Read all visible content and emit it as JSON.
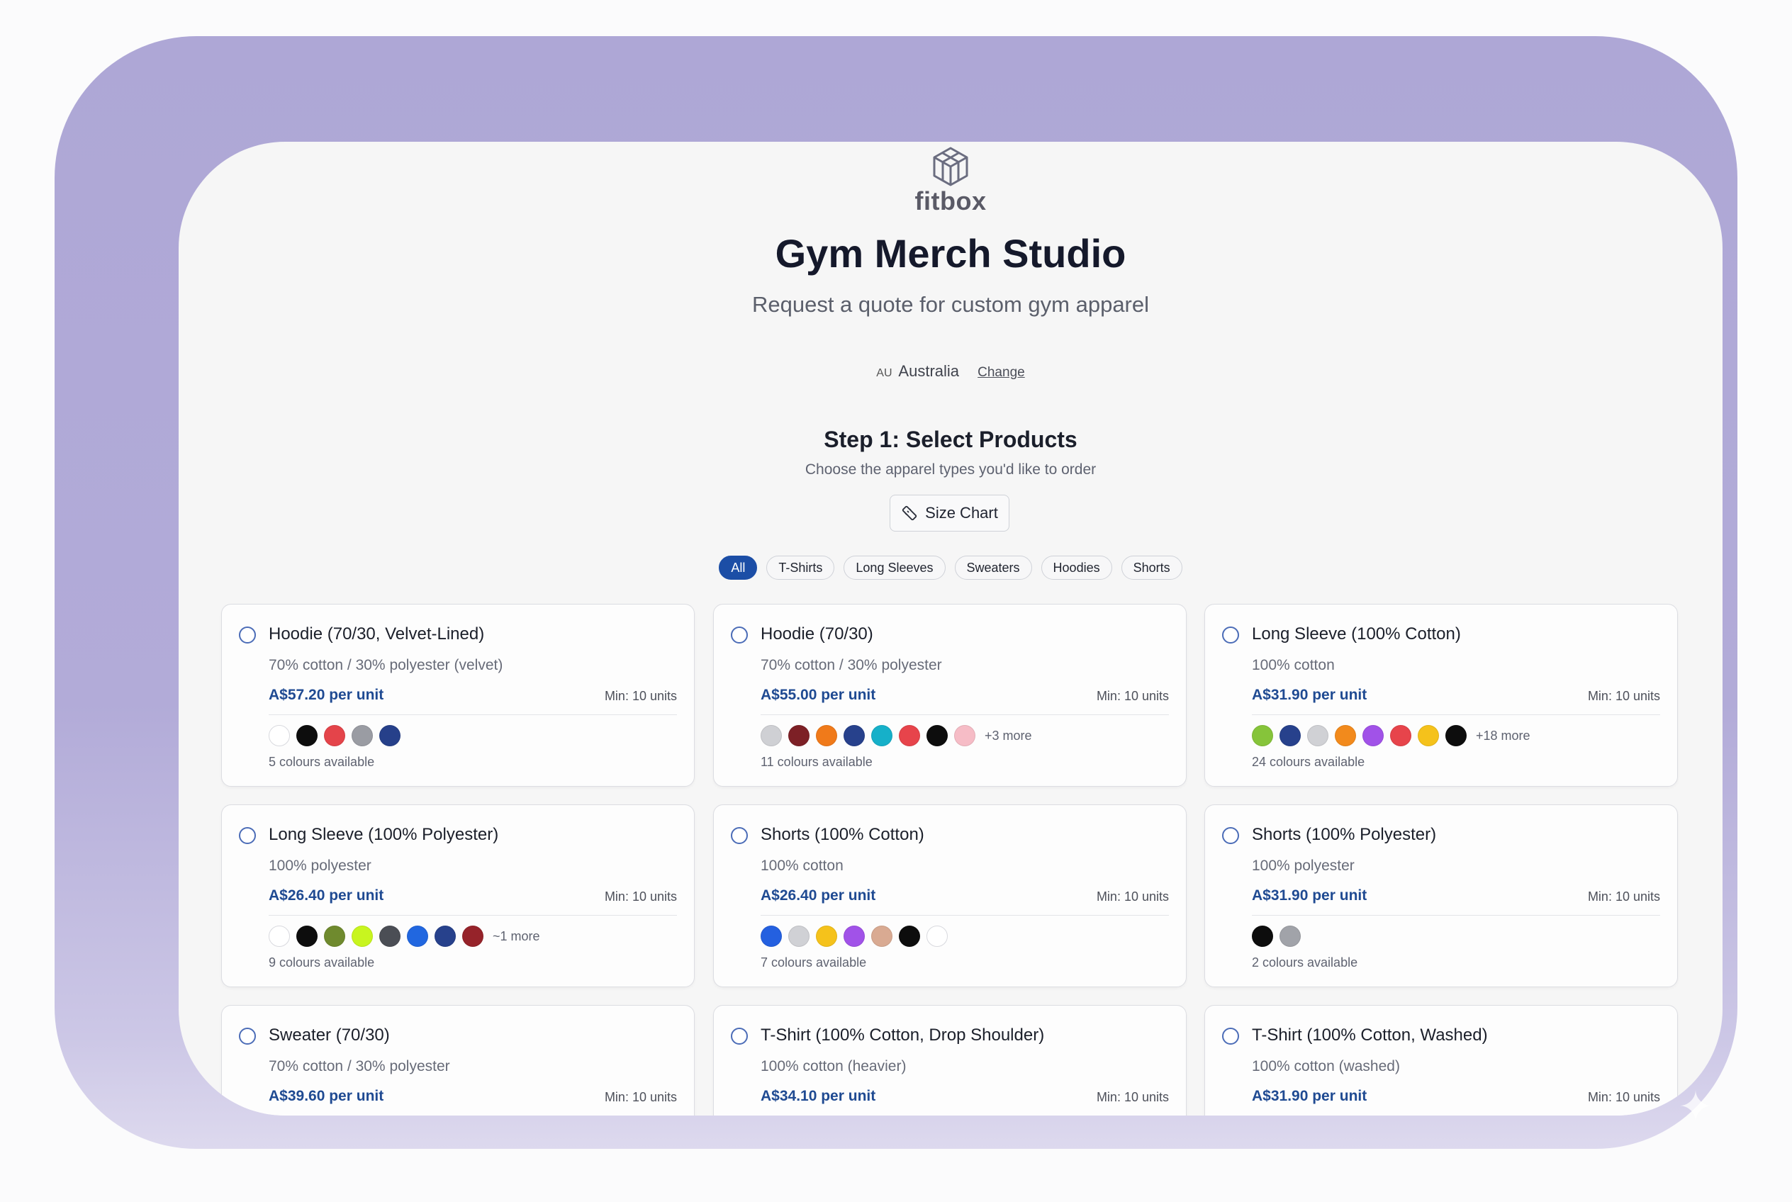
{
  "brand": {
    "logo_text": "fitbox"
  },
  "header": {
    "title": "Gym Merch Studio",
    "subtitle": "Request a quote for custom gym apparel"
  },
  "region": {
    "code": "AU",
    "name": "Australia",
    "change_label": "Change"
  },
  "step": {
    "title": "Step 1: Select Products",
    "subtitle": "Choose the apparel types you'd like to order",
    "size_chart_label": "Size Chart"
  },
  "filters": [
    "All",
    "T-Shirts",
    "Long Sleeves",
    "Sweaters",
    "Hoodies",
    "Shorts"
  ],
  "products": [
    {
      "name": "Hoodie (70/30, Velvet-Lined)",
      "material": "70% cotton / 30% polyester (velvet)",
      "price": "A$57.20 per unit",
      "min": "Min: 10 units",
      "colours": [
        "#ffffff",
        "#0d0d0d",
        "#e4444a",
        "#9a9ca3",
        "#26408a"
      ],
      "more": "",
      "count": "5 colours available"
    },
    {
      "name": "Hoodie (70/30)",
      "material": "70% cotton / 30% polyester",
      "price": "A$55.00 per unit",
      "min": "Min: 10 units",
      "colours": [
        "#cfd0d4",
        "#7d2026",
        "#f07a1a",
        "#27418c",
        "#16b0c9",
        "#e7444b",
        "#0d0d0d",
        "#f6bcc6"
      ],
      "more": "+3 more",
      "count": "11 colours available"
    },
    {
      "name": "Long Sleeve (100% Cotton)",
      "material": "100% cotton",
      "price": "A$31.90 per unit",
      "min": "Min: 10 units",
      "colours": [
        "#86c43a",
        "#27418c",
        "#d0d1d5",
        "#f28a1c",
        "#a152e8",
        "#e7444b",
        "#f5c21b",
        "#0d0d0d"
      ],
      "more": "+18 more",
      "count": "24 colours available"
    },
    {
      "name": "Long Sleeve (100% Polyester)",
      "material": "100% polyester",
      "price": "A$26.40 per unit",
      "min": "Min: 10 units",
      "colours": [
        "#ffffff",
        "#0d0d0d",
        "#6f8a2e",
        "#c8f51f",
        "#4b4e55",
        "#2167e0",
        "#27418c",
        "#96232a"
      ],
      "more": "~1 more",
      "count": "9 colours available"
    },
    {
      "name": "Shorts (100% Cotton)",
      "material": "100% cotton",
      "price": "A$26.40 per unit",
      "min": "Min: 10 units",
      "colours": [
        "#2460e0",
        "#d0d1d5",
        "#f5c21b",
        "#a152e8",
        "#d9aa92",
        "#0d0d0d",
        "#ffffff"
      ],
      "more": "",
      "count": "7 colours available"
    },
    {
      "name": "Shorts (100% Polyester)",
      "material": "100% polyester",
      "price": "A$31.90 per unit",
      "min": "Min: 10 units",
      "colours": [
        "#0d0d0d",
        "#a1a3a9"
      ],
      "more": "",
      "count": "2 colours available"
    },
    {
      "name": "Sweater (70/30)",
      "material": "70% cotton / 30% polyester",
      "price": "A$39.60 per unit",
      "min": "Min: 10 units",
      "colours": [],
      "more": "",
      "count": ""
    },
    {
      "name": "T-Shirt (100% Cotton, Drop Shoulder)",
      "material": "100% cotton (heavier)",
      "price": "A$34.10 per unit",
      "min": "Min: 10 units",
      "colours": [],
      "more": "",
      "count": ""
    },
    {
      "name": "T-Shirt (100% Cotton, Washed)",
      "material": "100% cotton (washed)",
      "price": "A$31.90 per unit",
      "min": "Min: 10 units",
      "colours": [],
      "more": "",
      "count": ""
    }
  ]
}
